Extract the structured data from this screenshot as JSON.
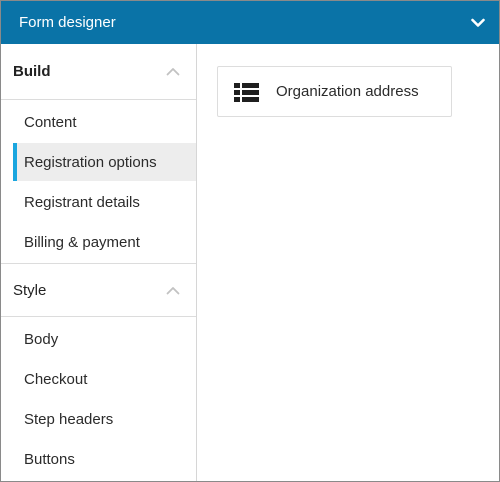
{
  "header": {
    "title": "Form designer"
  },
  "build_section": {
    "title": "Build",
    "items": [
      {
        "label": "Content"
      },
      {
        "label": "Registration options"
      },
      {
        "label": "Registrant details"
      },
      {
        "label": "Billing & payment"
      }
    ]
  },
  "style_section": {
    "title": "Style",
    "items": [
      {
        "label": "Body"
      },
      {
        "label": "Checkout"
      },
      {
        "label": "Step headers"
      },
      {
        "label": "Buttons"
      }
    ]
  },
  "main": {
    "field_card": {
      "label": "Organization address",
      "icon": "list-icon"
    }
  },
  "colors": {
    "header_bg": "#0a73a7",
    "active_accent": "#1aa6df",
    "active_bg": "#ededed"
  }
}
